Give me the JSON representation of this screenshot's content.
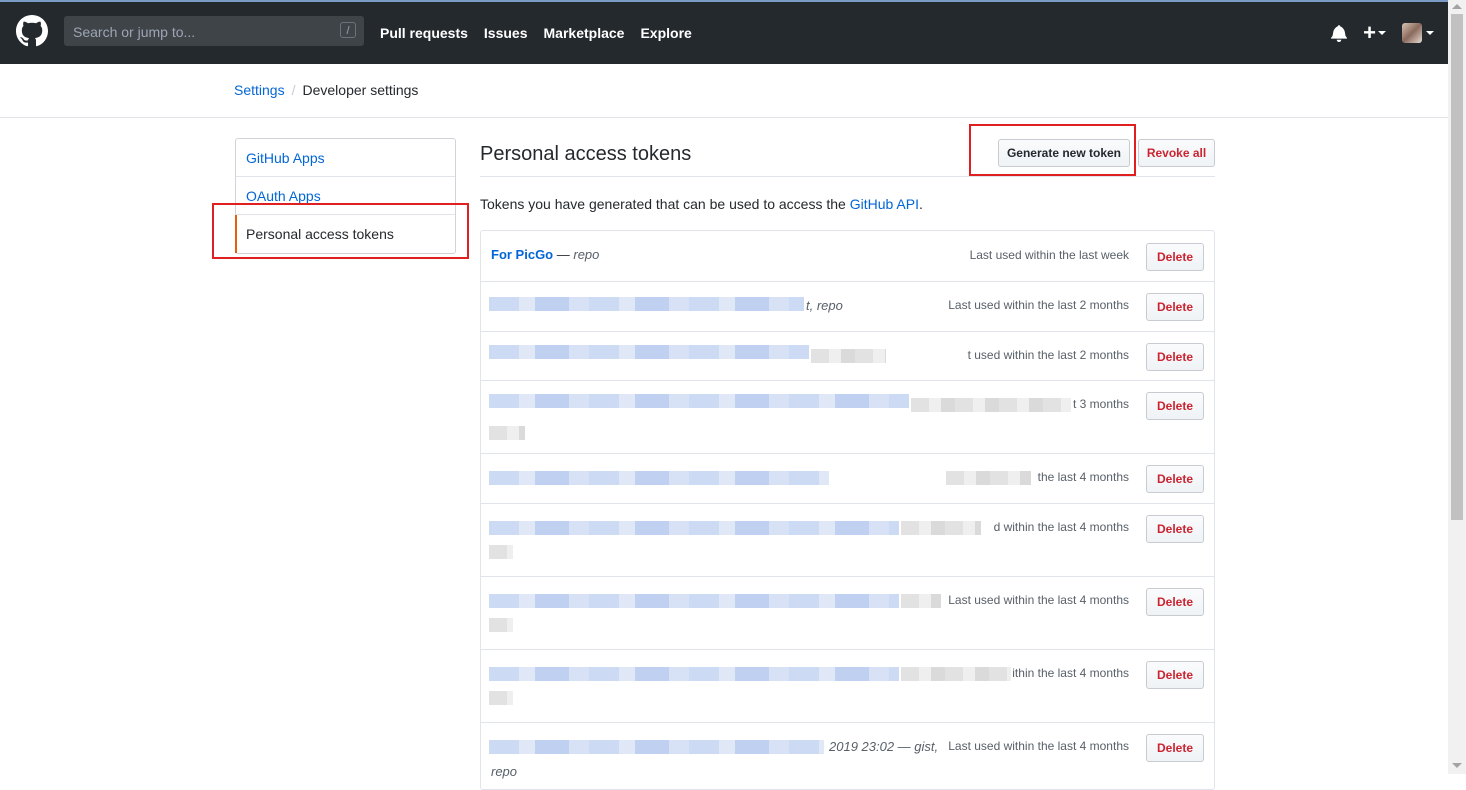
{
  "header": {
    "search_placeholder": "Search or jump to...",
    "search_shortcut": "/",
    "nav": [
      "Pull requests",
      "Issues",
      "Marketplace",
      "Explore"
    ],
    "plus_label": "+"
  },
  "breadcrumb": {
    "parent": "Settings",
    "separator": "/",
    "current": "Developer settings"
  },
  "sidebar": {
    "items": [
      {
        "label": "GitHub Apps"
      },
      {
        "label": "OAuth Apps"
      },
      {
        "label": "Personal access tokens"
      }
    ]
  },
  "main": {
    "title": "Personal access tokens",
    "generate_label": "Generate new token",
    "revoke_label": "Revoke all",
    "intro_prefix": "Tokens you have generated that can be used to access the ",
    "intro_link": "GitHub API",
    "intro_suffix": "."
  },
  "tokens": [
    {
      "name": "For PicGo",
      "scope_sep": " — ",
      "scope": "repo",
      "last_used": "Last used within the last week",
      "delete_label": "Delete"
    },
    {
      "tail": "t, repo",
      "last_used": "Last used within the last 2 months",
      "delete_label": "Delete"
    },
    {
      "last_used": "t used within the last 2 months",
      "delete_label": "Delete"
    },
    {
      "last_used": "t 3 months",
      "delete_label": "Delete"
    },
    {
      "last_used": "the last 4 months",
      "delete_label": "Delete"
    },
    {
      "last_used": "d within the last 4 months",
      "delete_label": "Delete"
    },
    {
      "last_used": "Last used within the last 4 months",
      "delete_label": "Delete"
    },
    {
      "last_used": "ithin the last 4 months",
      "delete_label": "Delete"
    },
    {
      "tail": "2019 23:02 — gist,",
      "tail2": "repo",
      "last_used": "Last used within the last 4 months",
      "delete_label": "Delete"
    }
  ]
}
